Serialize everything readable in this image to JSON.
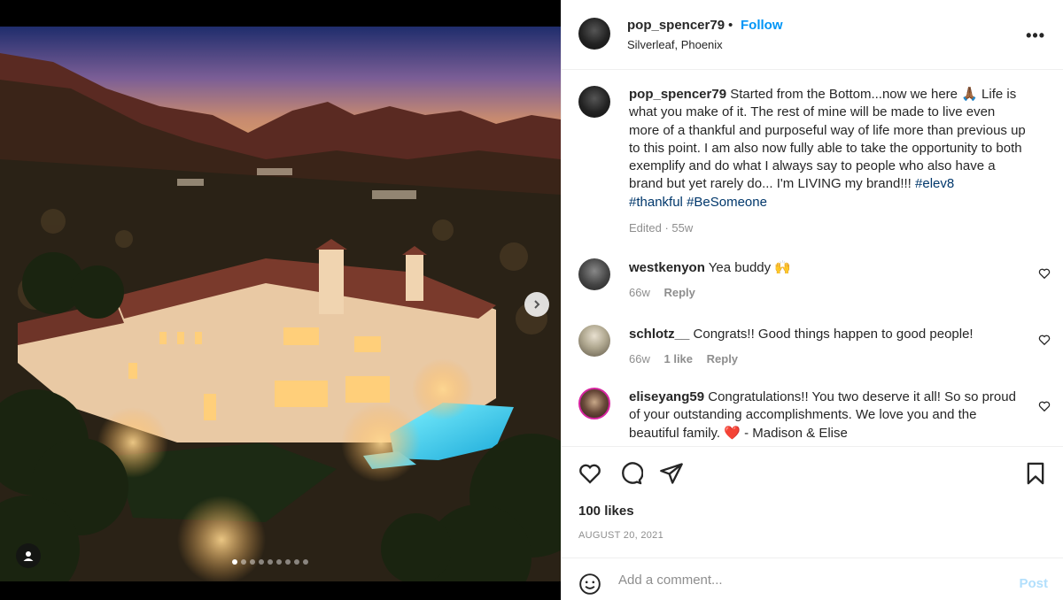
{
  "post": {
    "username": "pop_spencer79",
    "separator": "•",
    "follow_label": "Follow",
    "location": "Silverleaf, Phoenix",
    "more_icon": "more-horizontal-icon"
  },
  "caption": {
    "username": "pop_spencer79",
    "text": "Started from the Bottom...now we here 🙏🏾 Life is what you make of it. The rest of mine will be made to live even more of a thankful and purposeful way of life more than previous up to this point. I am also now fully able to take the opportunity to both exemplify and do what I always say to people who also have a brand but yet rarely do... I'm LIVING my brand!!!",
    "hashtags": [
      "#elev8",
      "#thankful",
      "#BeSomeone"
    ],
    "meta": "Edited · 55w"
  },
  "comments": [
    {
      "username": "westkenyon",
      "text": "Yea buddy 🙌",
      "time": "66w",
      "likes": "",
      "reply": "Reply"
    },
    {
      "username": "schlotz__",
      "text": "Congrats!! Good things happen to good people!",
      "time": "66w",
      "likes": "1 like",
      "reply": "Reply"
    },
    {
      "username": "eliseyang59",
      "text": "Congratulations!! You two deserve it all! So so proud of your outstanding accomplishments. We love you and the beautiful family. ❤️ - Madison & Elise",
      "time": "",
      "likes": "",
      "reply": ""
    }
  ],
  "actions": {
    "likes": "100 likes",
    "date": "AUGUST 20, 2021"
  },
  "add_comment": {
    "placeholder": "Add a comment...",
    "post_label": "Post"
  },
  "carousel": {
    "count": 9,
    "active_index": 0
  },
  "colors": {
    "accent": "#0095f6",
    "hashtag": "#00376b",
    "muted": "#8e8e8e",
    "post_disabled": "#b2dffc"
  }
}
